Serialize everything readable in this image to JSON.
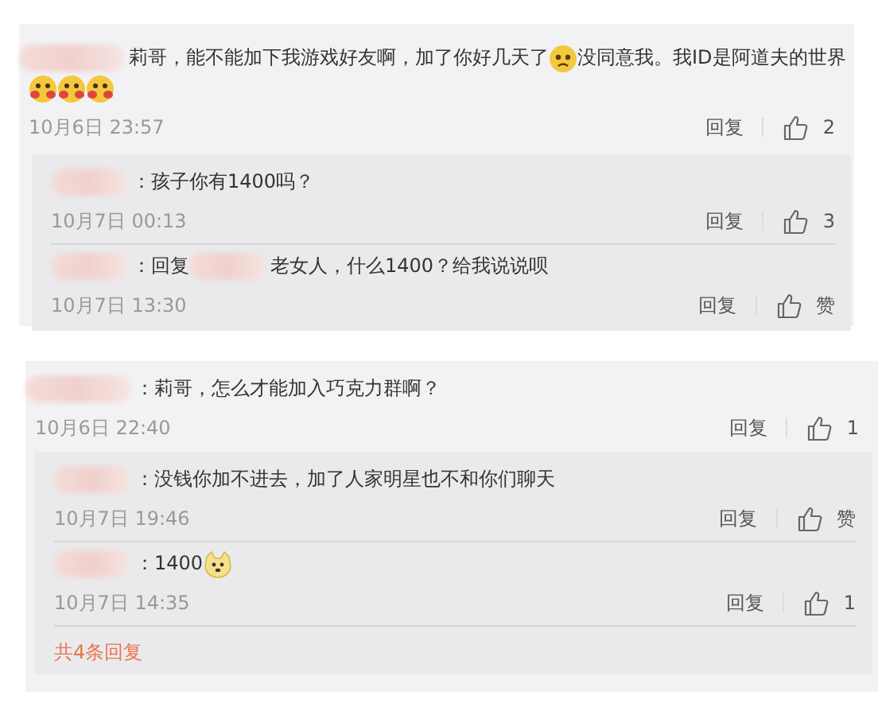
{
  "threads": [
    {
      "comment": {
        "content": [
          {
            "kind": "name"
          },
          {
            "kind": "text",
            "text": "莉哥，能不能加下我游戏好友啊，加了你好几天了"
          },
          {
            "kind": "sad"
          },
          {
            "kind": "text",
            "text": "没同意我。我ID是阿道夫的世界"
          },
          {
            "kind": "break"
          },
          {
            "kind": "blush"
          },
          {
            "kind": "blush"
          },
          {
            "kind": "blush"
          }
        ],
        "time": "10月6日 23:57",
        "reply_label": "回复",
        "likes": "2"
      },
      "replies": [
        {
          "content": [
            {
              "kind": "name"
            },
            {
              "kind": "text",
              "text": "：孩子你有1400吗？"
            }
          ],
          "time": "10月7日 00:13",
          "reply_label": "回复",
          "likes": "3"
        },
        {
          "content": [
            {
              "kind": "name"
            },
            {
              "kind": "text",
              "text": "：回复"
            },
            {
              "kind": "name"
            },
            {
              "kind": "text",
              "text": "老女人，什么1400？给我说说呗"
            }
          ],
          "time": "10月7日 13:30",
          "reply_label": "回复",
          "likes": "赞"
        }
      ]
    },
    {
      "comment": {
        "content": [
          {
            "kind": "name"
          },
          {
            "kind": "text",
            "text": "：莉哥，怎么才能加入巧克力群啊？"
          }
        ],
        "time": "10月6日 22:40",
        "reply_label": "回复",
        "likes": "1"
      },
      "replies": [
        {
          "content": [
            {
              "kind": "name"
            },
            {
              "kind": "text",
              "text": "：没钱你加不进去，加了人家明星也不和你们聊天"
            }
          ],
          "time": "10月7日 19:46",
          "reply_label": "回复",
          "likes": "赞"
        },
        {
          "content": [
            {
              "kind": "name"
            },
            {
              "kind": "text",
              "text": "：1400"
            },
            {
              "kind": "dog"
            }
          ],
          "time": "10月7日 14:35",
          "reply_label": "回复",
          "likes": "1"
        }
      ],
      "more_link": "共4条回复"
    }
  ]
}
